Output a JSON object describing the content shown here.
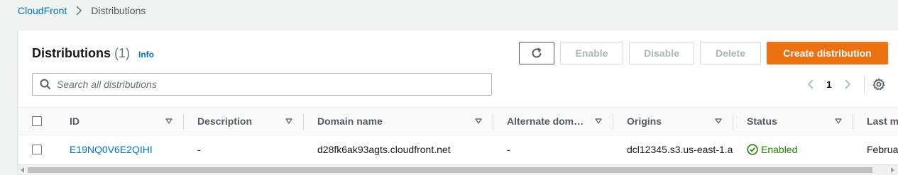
{
  "breadcrumb": {
    "root": "CloudFront",
    "current": "Distributions"
  },
  "header": {
    "title": "Distributions",
    "count": "(1)",
    "info": "Info"
  },
  "toolbar": {
    "refresh_icon": "refresh-icon",
    "enable": "Enable",
    "disable": "Disable",
    "delete": "Delete",
    "create": "Create distribution"
  },
  "search": {
    "placeholder": "Search all distributions",
    "value": ""
  },
  "pagination": {
    "current_page": "1"
  },
  "table": {
    "columns": [
      "ID",
      "Description",
      "Domain name",
      "Alternate dom…",
      "Origins",
      "Status",
      "Last m"
    ],
    "rows": [
      {
        "id": "E19NQ0V6E2QIHI",
        "description": "-",
        "domain": "d28fk6ak93agts.cloudfront.net",
        "alternate": "-",
        "origins": "dcl12345.s3.us-east-1.a",
        "status": "Enabled",
        "last_modified": "Februar"
      }
    ]
  },
  "colors": {
    "link": "#0073bb",
    "primary": "#ec7211",
    "success": "#1d8102"
  }
}
